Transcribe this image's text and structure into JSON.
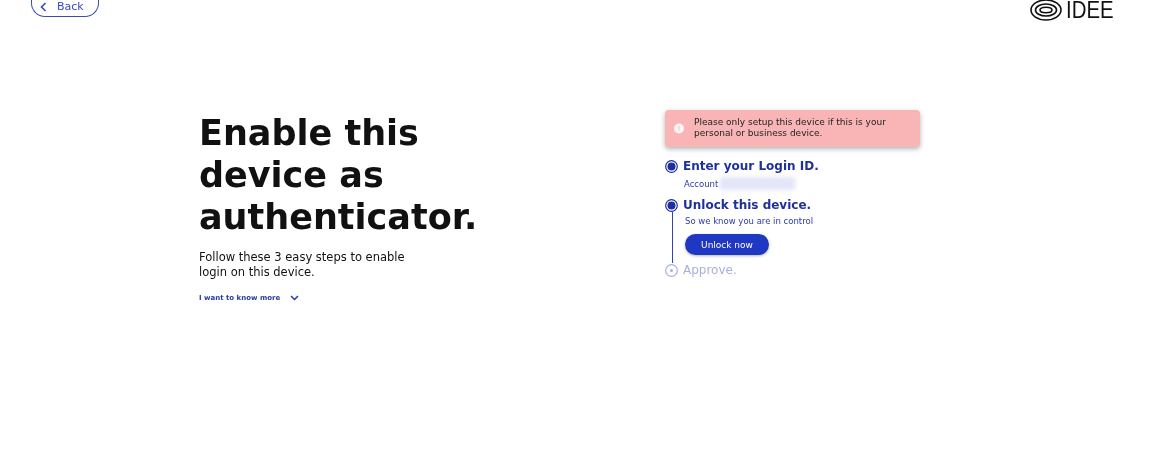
{
  "back_button": {
    "label": "Back"
  },
  "logo": {
    "text": "IDEE"
  },
  "heading": "Enable this device as authenticator.",
  "subtitle": "Follow these 3 easy steps to enable login on this device.",
  "more_link": {
    "label": "I want to know more",
    "expanded": false
  },
  "alert": {
    "text": "Please only setup this device if this is your personal or business device."
  },
  "steps": [
    {
      "title": "Enter your Login ID.",
      "kind": "done",
      "field_label": "Account"
    },
    {
      "title": "Unlock this device.",
      "kind": "active",
      "note": "So we know you are in control",
      "button": "Unlock now"
    },
    {
      "title": "Approve.",
      "kind": "pending"
    }
  ]
}
